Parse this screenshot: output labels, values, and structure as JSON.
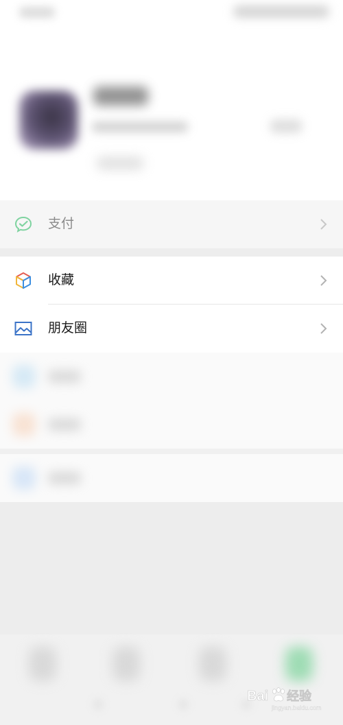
{
  "menu": {
    "pay": {
      "label": "支付",
      "icon": "wechat-pay-icon"
    },
    "favorites": {
      "label": "收藏",
      "icon": "cube-icon"
    },
    "moments": {
      "label": "朋友圈",
      "icon": "image-icon"
    }
  },
  "colors": {
    "pay_green": "#07c160",
    "moments_blue": "#3b73c7",
    "background": "#ededed"
  },
  "watermark": {
    "text": "Bai du 经验",
    "subtext": "jingyan.baidu.com"
  }
}
